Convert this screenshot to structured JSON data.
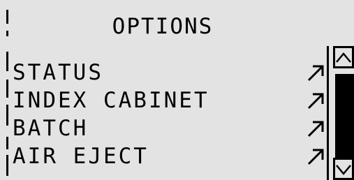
{
  "screen": {
    "title": "OPTIONS"
  },
  "menu": {
    "items": [
      {
        "label": "STATUS",
        "icon": "submenu-arrow-icon"
      },
      {
        "label": "INDEX CABINET",
        "icon": "submenu-arrow-icon"
      },
      {
        "label": "BATCH",
        "icon": "submenu-arrow-icon"
      },
      {
        "label": "AIR EJECT",
        "icon": "submenu-arrow-icon"
      }
    ]
  },
  "scrollbar": {
    "up_icon": "chevron-up-icon",
    "down_icon": "chevron-down-icon"
  },
  "colors": {
    "background": "#e3e3e3",
    "foreground": "#000000"
  }
}
